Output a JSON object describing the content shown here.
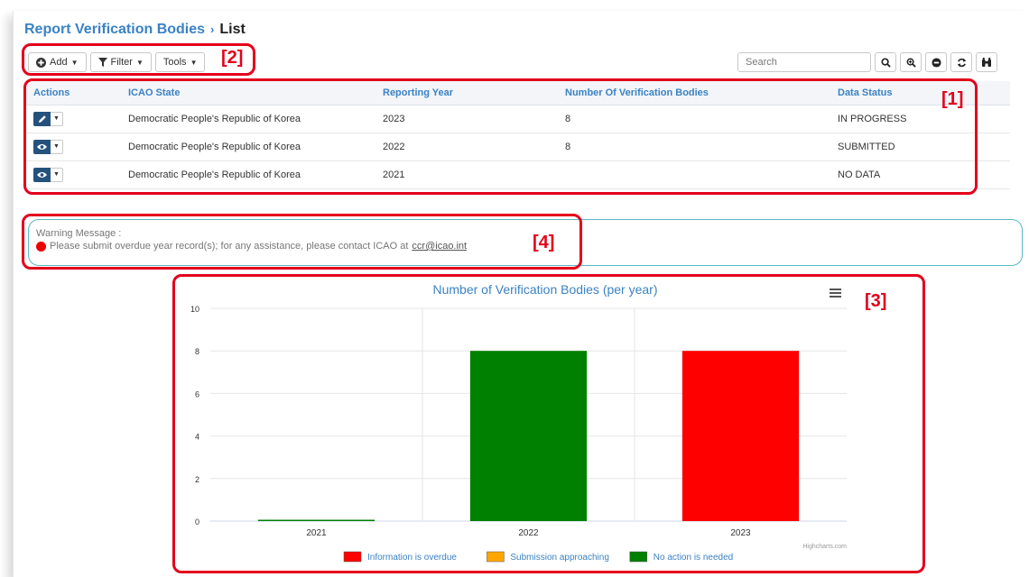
{
  "breadcrumb": {
    "parent": "Report Verification Bodies",
    "separator": "›",
    "current": "List"
  },
  "toolbar": {
    "add_label": "Add",
    "filter_label": "Filter",
    "tools_label": "Tools"
  },
  "search": {
    "placeholder": "Search"
  },
  "table": {
    "headers": [
      "Actions",
      "ICAO State",
      "Reporting Year",
      "Number Of Verification Bodies",
      "Data Status"
    ],
    "rows": [
      {
        "action_icon": "pencil-icon",
        "state": "Democratic People's Republic of Korea",
        "year": "2023",
        "count": "8",
        "status": "IN PROGRESS",
        "status_color": "#e3212b"
      },
      {
        "action_icon": "eye-icon",
        "state": "Democratic People's Republic of Korea",
        "year": "2022",
        "count": "8",
        "status": "SUBMITTED",
        "status_color": "#2e8b2e"
      },
      {
        "action_icon": "eye-icon",
        "state": "Democratic People's Republic of Korea",
        "year": "2021",
        "count": "",
        "status": "NO DATA",
        "status_color": "#2e8b2e"
      }
    ]
  },
  "warning": {
    "title": "Warning Message :",
    "text": "Please submit overdue year record(s); for any assistance, please contact ICAO at",
    "email": "ccr@icao.int"
  },
  "annotations": {
    "a1": "[1]",
    "a2": "[2]",
    "a3": "[3]",
    "a4": "[4]"
  },
  "chart_data": {
    "type": "bar",
    "title": "Number of Verification Bodies (per year)",
    "categories": [
      "2021",
      "2022",
      "2023"
    ],
    "values": [
      0,
      8,
      8
    ],
    "bar_colors": [
      "#008000",
      "#008000",
      "#ff0000"
    ],
    "ylim": [
      0,
      10
    ],
    "yticks": [
      0,
      2,
      4,
      6,
      8,
      10
    ],
    "grid": true,
    "credits": "Highcharts.com",
    "legend": [
      {
        "name": "Information is overdue",
        "color": "#ff0000"
      },
      {
        "name": "Submission approaching",
        "color": "#ffa500"
      },
      {
        "name": "No action is needed",
        "color": "#008000"
      }
    ],
    "legend_position": "bottom-center"
  },
  "colors": {
    "accent": "#3b82c4",
    "action_button": "#24527c",
    "annotation": "#e3001b"
  }
}
